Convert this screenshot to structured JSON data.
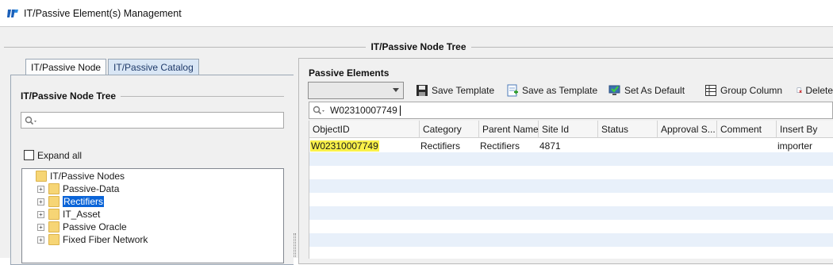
{
  "window": {
    "title": "IT/Passive Element(s) Management"
  },
  "main": {
    "group_title": "IT/Passive Node Tree"
  },
  "tabs": [
    {
      "label": "IT/Passive Node",
      "active": true
    },
    {
      "label": "IT/Passive Catalog",
      "active": false
    }
  ],
  "left": {
    "group_title": "IT/Passive Node Tree",
    "search": {
      "value": "",
      "placeholder": ""
    },
    "expand_all": {
      "label": "Expand all",
      "checked": false
    },
    "tree": {
      "root": "IT/Passive Nodes",
      "children": [
        {
          "label": "Passive-Data",
          "selected": false
        },
        {
          "label": "Rectifiers",
          "selected": true
        },
        {
          "label": "IT_Asset",
          "selected": false
        },
        {
          "label": "Passive Oracle",
          "selected": false
        },
        {
          "label": "Fixed Fiber Network",
          "selected": false
        }
      ]
    }
  },
  "right": {
    "group_title": "Passive Elements",
    "toolbar": {
      "template_select": "",
      "save_template": "Save Template",
      "save_as_template": "Save as Template",
      "set_as_default": "Set As Default",
      "group_column": "Group Column",
      "delete": "Delete"
    },
    "filter": {
      "value": "W02310007749"
    },
    "table": {
      "columns": [
        "ObjectID",
        "Category",
        "Parent Name",
        "Site Id",
        "Status",
        "Approval S...",
        "Comment",
        "Insert By"
      ],
      "rows": [
        [
          "W02310007749",
          "Rectifiers",
          "Rectifiers",
          "4871",
          "",
          "",
          "",
          "importer"
        ]
      ]
    }
  },
  "colors": {
    "selection": "#0a64d8",
    "highlight": "#f9f14a",
    "row_stripe": "#e8f0fa",
    "inactive_tab": "#d9e6f5"
  }
}
